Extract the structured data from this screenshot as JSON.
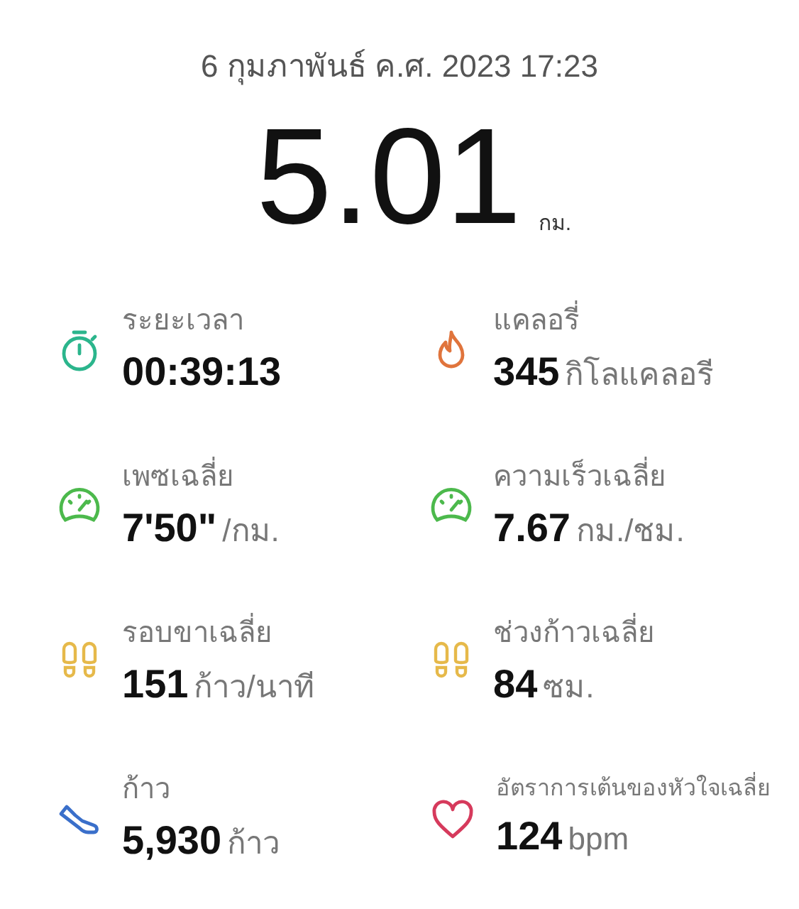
{
  "date": "6 กุมภาพันธ์ ค.ศ. 2023 17:23",
  "distance": {
    "value": "5.01",
    "unit": "กม."
  },
  "stats": [
    {
      "kind": "stopwatch",
      "label": "ระยะเวลา",
      "value": "00:39:13"
    },
    {
      "kind": "flame",
      "label": "แคลอรี่",
      "value": "345",
      "unit": "กิโลแคลอรี"
    },
    {
      "kind": "gauge",
      "label": "เพซเฉลี่ย",
      "value": "7'50\"",
      "unit": "/กม."
    },
    {
      "kind": "gauge",
      "label": "ความเร็วเฉลี่ย",
      "value": "7.67",
      "unit": "กม./ชม."
    },
    {
      "kind": "footprints",
      "label": "รอบขาเฉลี่ย",
      "value": "151",
      "unit": "ก้าว/นาที"
    },
    {
      "kind": "footprints",
      "label": "ช่วงก้าวเฉลี่ย",
      "value": "84",
      "unit": "ซม."
    },
    {
      "kind": "shoe",
      "label": "ก้าว",
      "value": "5,930",
      "unit": "ก้าว"
    },
    {
      "kind": "heart",
      "label": "อัตราการเต้นของหัวใจเฉลี่ย",
      "value": "124",
      "unit": "bpm",
      "small_label": true
    }
  ]
}
